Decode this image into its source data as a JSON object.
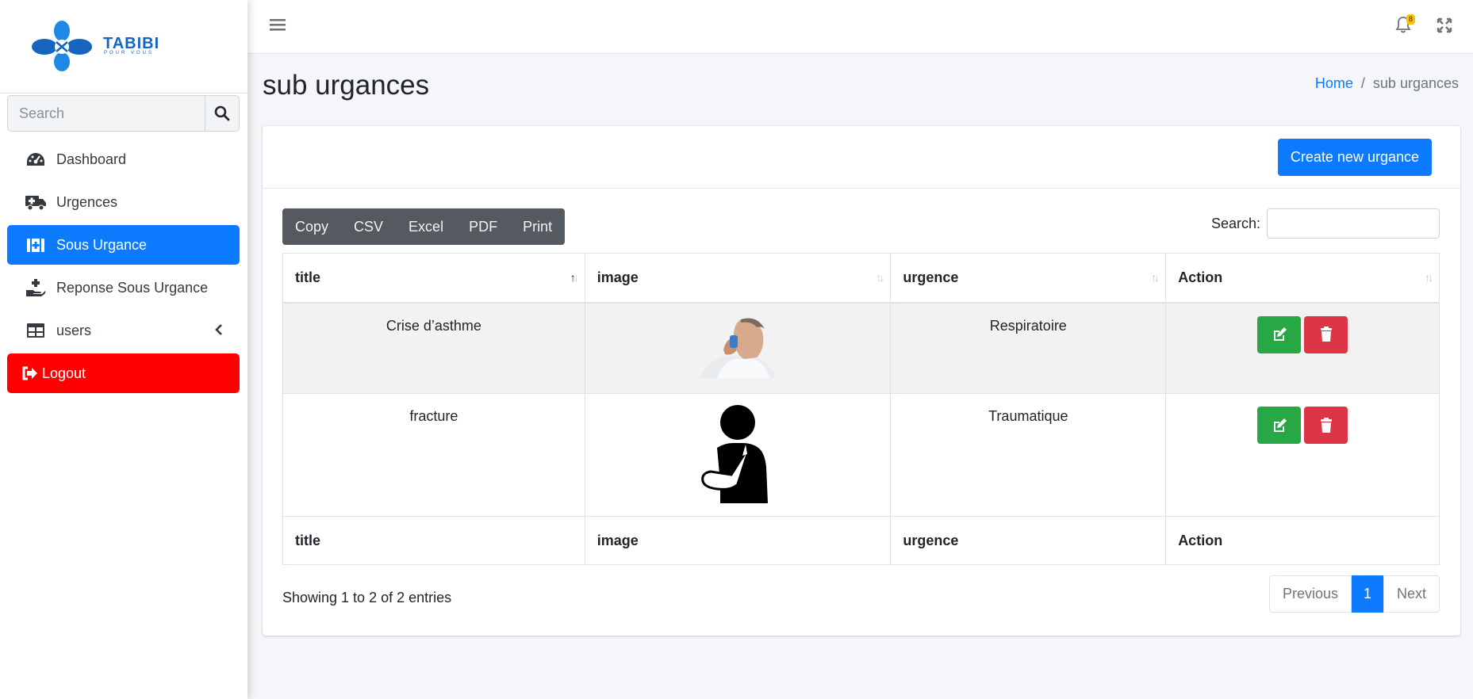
{
  "brand": {
    "name": "TABIBI",
    "tagline": "POUR VOUS"
  },
  "sidebar": {
    "search_placeholder": "Search",
    "items": [
      {
        "label": "Dashboard",
        "icon": "dashboard-icon"
      },
      {
        "label": "Urgences",
        "icon": "ambulance-icon"
      },
      {
        "label": "Sous Urgance",
        "icon": "medkit-icon",
        "active": true
      },
      {
        "label": "Reponse Sous Urgance",
        "icon": "hand-holding-medical-icon"
      },
      {
        "label": "users",
        "icon": "table-icon"
      },
      {
        "label": "Logout",
        "icon": "sign-out-icon"
      }
    ]
  },
  "topbar": {
    "notification_count": "8"
  },
  "header": {
    "title": "sub urgances",
    "breadcrumb": {
      "home": "Home",
      "current": "sub urgances"
    }
  },
  "card": {
    "create_button": "Create new urgance",
    "export_buttons": [
      "Copy",
      "CSV",
      "Excel",
      "PDF",
      "Print"
    ],
    "search_label": "Search:",
    "columns": [
      "title",
      "image",
      "urgence",
      "Action"
    ],
    "rows": [
      {
        "title": "Crise d’asthme",
        "image": "asthma-inhaler-person-photo",
        "urgence": "Respiratoire"
      },
      {
        "title": "fracture",
        "image": "arm-sling-person-icon",
        "urgence": "Traumatique"
      }
    ],
    "info": "Showing 1 to 2 of 2 entries",
    "pagination": {
      "previous": "Previous",
      "current": "1",
      "next": "Next"
    }
  },
  "colors": {
    "primary": "#0d7bff",
    "logout": "#ff0000",
    "edit": "#28a745",
    "delete": "#dc3545",
    "badge": "#ffc107"
  }
}
